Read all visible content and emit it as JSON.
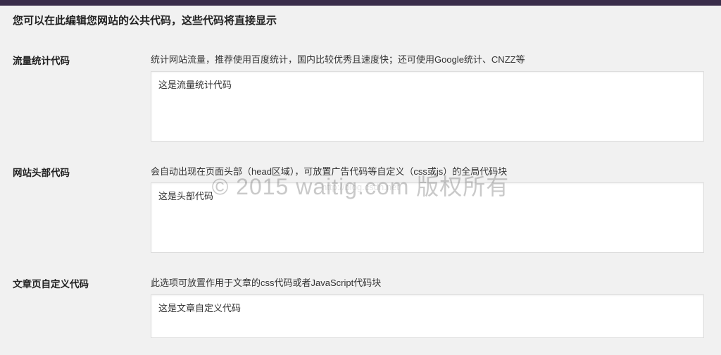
{
  "header": {
    "title": "您可以在此编辑您网站的公共代码，这些代码将直接显示"
  },
  "sections": {
    "traffic": {
      "label": "流量统计代码",
      "description": "统计网站流量，推荐使用百度统计，国内比较优秀且速度快；还可使用Google统计、CNZZ等",
      "value": "这是流量统计代码"
    },
    "head": {
      "label": "网站头部代码",
      "description": "会自动出现在页面头部（head区域），可放置广告代码等自定义（css或js）的全局代码块",
      "value": "这是头部代码"
    },
    "article": {
      "label": "文章页自定义代码",
      "description": "此选项可放置作用于文章的css代码或者JavaScript代码块",
      "value": "这是文章自定义代码"
    }
  },
  "watermark": {
    "main": "© 2015 waitig.com 版权所有",
    "sub": "http://blog.csdn.net"
  }
}
